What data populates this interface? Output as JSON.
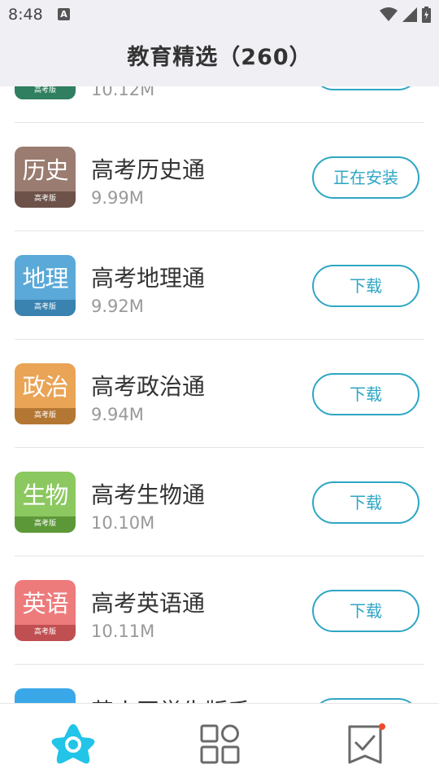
{
  "status": {
    "time": "8:48",
    "a_badge": "A"
  },
  "title": "教育精选（260）",
  "apps": [
    {
      "name": "",
      "size": "10.12M",
      "icon_text": "",
      "icon_foot": "高考版",
      "button": "",
      "color_main": "#4aa37f",
      "color_foot": "#2f7f60"
    },
    {
      "name": "高考历史通",
      "size": "9.99M",
      "icon_text": "历史",
      "icon_foot": "高考版",
      "button": "正在安装",
      "color_main": "#9a7c71",
      "color_foot": "#6d524a"
    },
    {
      "name": "高考地理通",
      "size": "9.92M",
      "icon_text": "地理",
      "icon_foot": "高考版",
      "button": "下载",
      "color_main": "#5aa9d8",
      "color_foot": "#3a82b0"
    },
    {
      "name": "高考政治通",
      "size": "9.94M",
      "icon_text": "政治",
      "icon_foot": "高考版",
      "button": "下载",
      "color_main": "#e9a456",
      "color_foot": "#b47733"
    },
    {
      "name": "高考生物通",
      "size": "10.10M",
      "icon_text": "生物",
      "icon_foot": "高考版",
      "button": "下载",
      "color_main": "#8cc860",
      "color_foot": "#5d9838"
    },
    {
      "name": "高考英语通",
      "size": "10.11M",
      "icon_text": "英语",
      "icon_foot": "高考版",
      "button": "下载",
      "color_main": "#ee7b7c",
      "color_foot": "#c04f51"
    },
    {
      "name": "英小网学生版手",
      "size": "",
      "icon_text": "",
      "icon_foot": "",
      "button": "",
      "color_main": "#3aa8e8",
      "color_foot": "#2a86c0"
    }
  ],
  "colors": {
    "accent": "#2fa6c4",
    "nav_active": "#22c4e8",
    "nav_inactive": "#6a6a6a",
    "badge": "#f04a2a"
  },
  "nav": [
    {
      "name": "featured",
      "icon": "star-icon",
      "active": true
    },
    {
      "name": "categories",
      "icon": "grid-icon",
      "active": false
    },
    {
      "name": "tasks",
      "icon": "checklist-icon",
      "active": false,
      "has_badge": true
    }
  ]
}
